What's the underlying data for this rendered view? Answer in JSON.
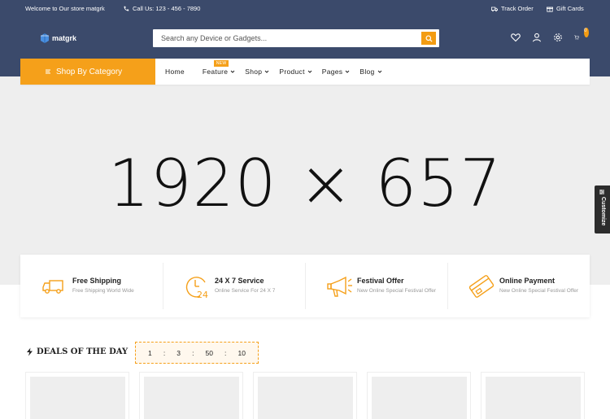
{
  "topbar": {
    "welcome": "Welcome to Our store matgrk",
    "call": "Call Us: 123 - 456 - 7890",
    "track_order": "Track Order",
    "gift_cards": "Gift Cards"
  },
  "header": {
    "logo": "matgrk",
    "search_placeholder": "Search any Device or Gadgets...",
    "cart_count": "0"
  },
  "nav": {
    "category_button": "Shop By Category",
    "items": [
      {
        "label": "Home"
      },
      {
        "label": "Feature",
        "badge": "NEW"
      },
      {
        "label": "Shop"
      },
      {
        "label": "Product"
      },
      {
        "label": "Pages"
      },
      {
        "label": "Blog"
      }
    ]
  },
  "hero": {
    "placeholder_text": "1920 × 657"
  },
  "customize": "Customize",
  "features": [
    {
      "title": "Free Shipping",
      "subtitle": "Free Shipping World Wide",
      "icon": "truck-icon"
    },
    {
      "title": "24 X 7 Service",
      "subtitle": "Online Service For 24 X 7",
      "icon": "clock-24-icon"
    },
    {
      "title": "Festival Offer",
      "subtitle": "New Online Special Festival Offer",
      "icon": "megaphone-icon"
    },
    {
      "title": "Online Payment",
      "subtitle": "New Online Special Festival Offer",
      "icon": "credit-card-icon"
    }
  ],
  "deals": {
    "title": "DEALS OF THE DAY",
    "timer": {
      "days": "1",
      "hours": "3",
      "minutes": "50",
      "seconds": "10",
      "separator": ":"
    }
  },
  "colors": {
    "header_bg": "#3b4a6b",
    "accent": "#f5a01a",
    "hero_bg": "#eeeeee"
  }
}
